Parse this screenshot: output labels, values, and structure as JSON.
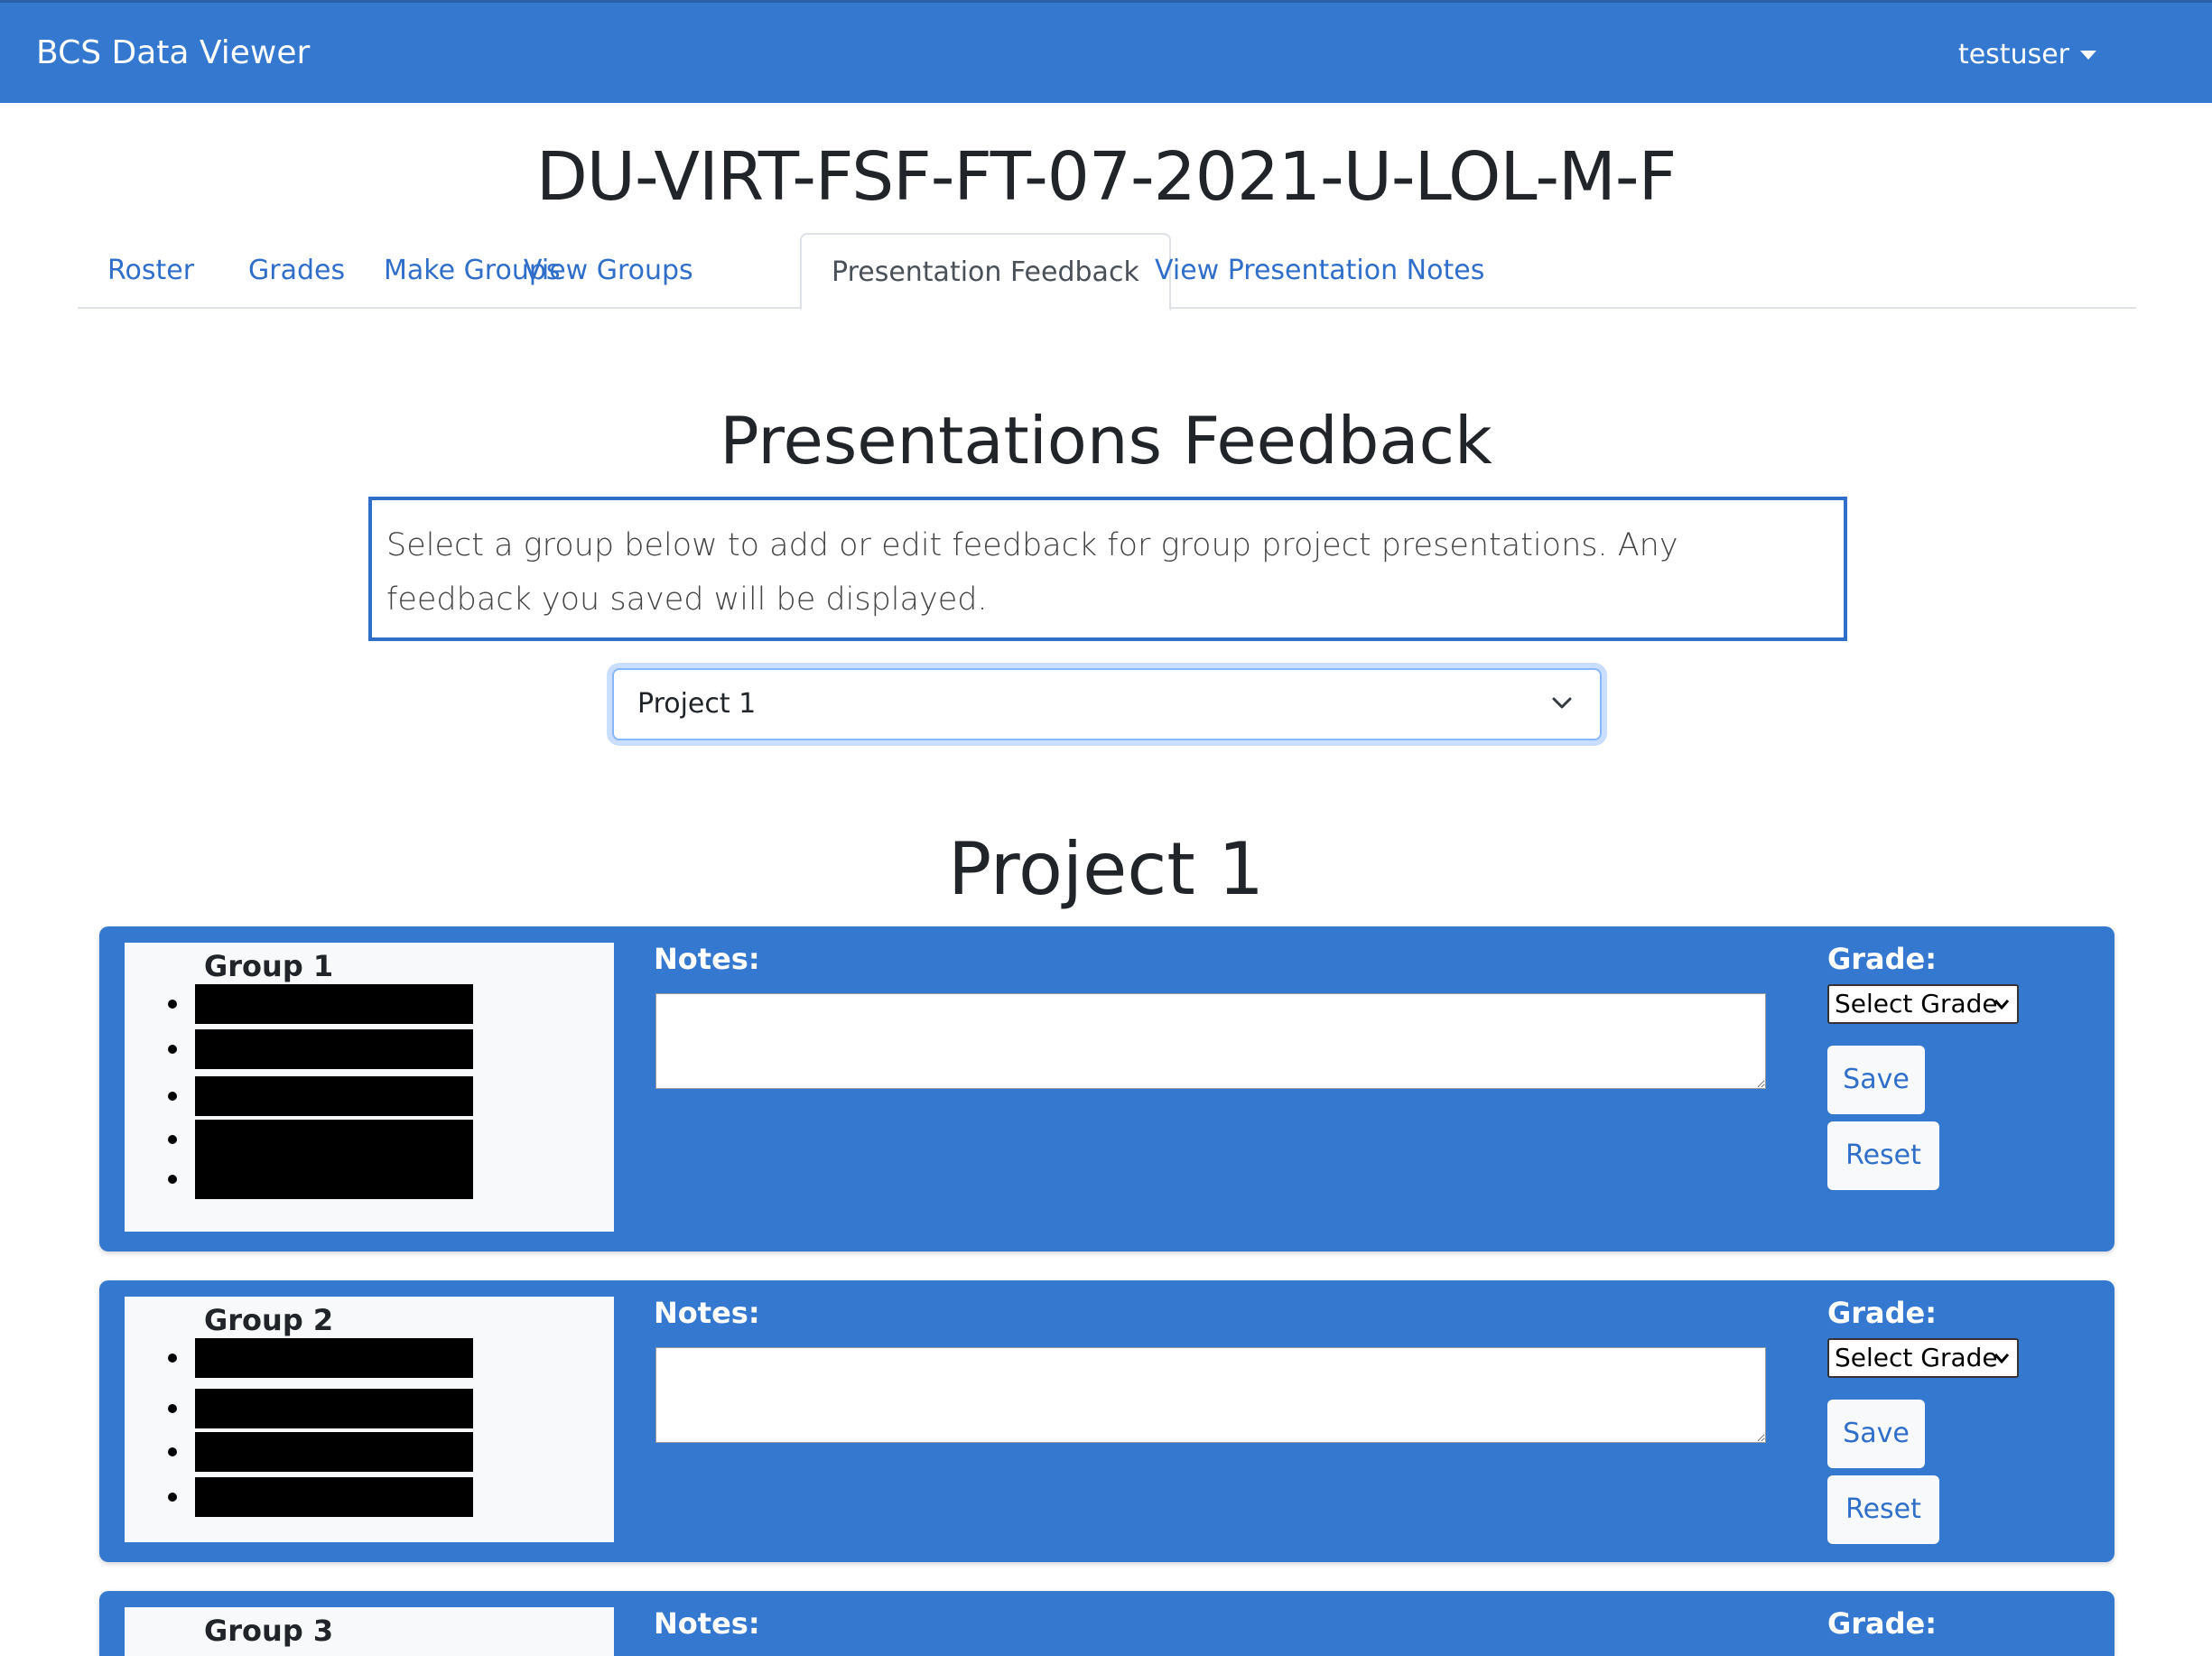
{
  "navbar": {
    "brand": "BCS Data Viewer",
    "user": "testuser"
  },
  "cohort_title": "DU-VIRT-FSF-FT-07-2021-U-LOL-M-F",
  "tabs": [
    {
      "label": "Roster"
    },
    {
      "label": "Grades"
    },
    {
      "label": "Make Groups"
    },
    {
      "label": "View Groups"
    },
    {
      "label": "Presentation Feedback",
      "active": true
    },
    {
      "label": "View Presentation Notes"
    }
  ],
  "page": {
    "heading": "Presentations Feedback",
    "instructions": "Select a group below to add or edit feedback for group project presentations. Any feedback you saved will be displayed.",
    "project_select": "Project 1",
    "project_heading": "Project 1"
  },
  "labels": {
    "notes": "Notes:",
    "grade": "Grade:",
    "grade_placeholder": "Select Grade",
    "save": "Save",
    "reset": "Reset"
  },
  "groups": [
    {
      "name": "Group 1",
      "member_count": 5
    },
    {
      "name": "Group 2",
      "member_count": 4
    },
    {
      "name": "Group 3"
    }
  ],
  "colors": {
    "primary": "#3478cf",
    "link": "#2f6fca"
  }
}
